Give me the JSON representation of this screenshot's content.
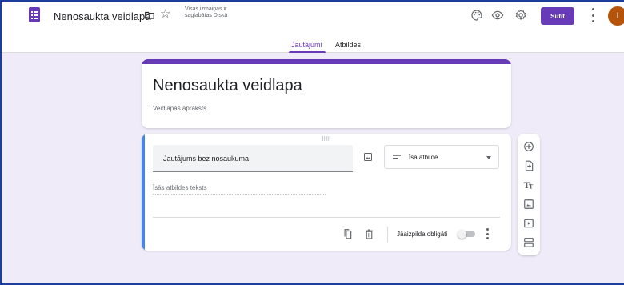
{
  "app": {
    "doc_title": "Nenosaukta veidlapa",
    "save_status": "Visas izmaiņas ir saglabātas Diskā",
    "send_label": "Sūtīt",
    "avatar_initial": "I",
    "icons": [
      "forms-logo-icon",
      "folder-icon",
      "star-icon",
      "palette-icon",
      "eye-icon",
      "gear-icon",
      "more-vert-icon"
    ]
  },
  "tabs": [
    {
      "label": "Jautājumi",
      "active": true
    },
    {
      "label": "Atbildes",
      "active": false
    }
  ],
  "form": {
    "title": "Nenosaukta veidlapa",
    "description_placeholder": "Veidlapas apraksts"
  },
  "question": {
    "title": "Jautājums bez nosaukuma",
    "type_label": "Īsā atbilde",
    "answer_hint": "Īsās atbildes teksts",
    "required_label": "Jāaizpilda obligāti",
    "required": false
  },
  "toolbar": {
    "icons": [
      "add-question-icon",
      "import-questions-icon",
      "add-title-icon",
      "add-image-icon",
      "add-video-icon",
      "add-section-icon"
    ]
  },
  "colors": {
    "accent": "#673ab7",
    "question_focus": "#4285f4",
    "background": "#f0ebf8",
    "avatar": "#b45309"
  }
}
